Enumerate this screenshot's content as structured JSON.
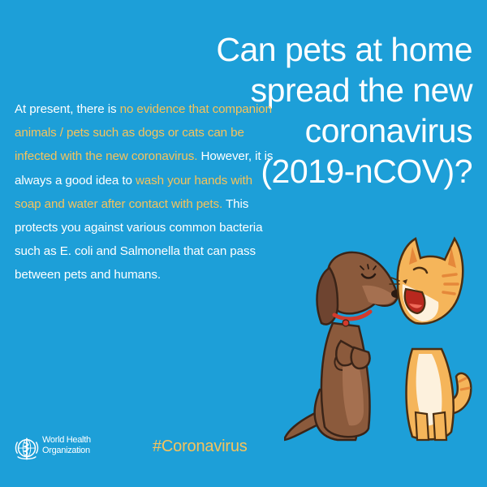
{
  "headline": {
    "lines": [
      "Can pets at home",
      "spread the new",
      "coronavirus",
      "(2019-nCOV)?"
    ]
  },
  "body": {
    "seg1": "At present, there is ",
    "seg2": "no evidence that companion animals / pets such as dogs or cats can be infected with the new coronavirus.",
    "seg3": " However, it is always a good idea to ",
    "seg4": "wash your hands with soap and water after contact with pets.",
    "seg5": " This protects you against various common bacteria such as E. coli and Salmonella that can pass between pets and humans."
  },
  "footer": {
    "org_line1": "World Health",
    "org_line2": "Organization",
    "hashtag": "#Coronavirus"
  },
  "illustration": {
    "icons": [
      "dog-illustration",
      "cat-illustration",
      "who-emblem-icon"
    ]
  },
  "colors": {
    "background": "#1d9fd8",
    "highlight": "#f7c35b",
    "text": "#ffffff",
    "dog": "#8b5a3c",
    "cat": "#f5b55a"
  }
}
